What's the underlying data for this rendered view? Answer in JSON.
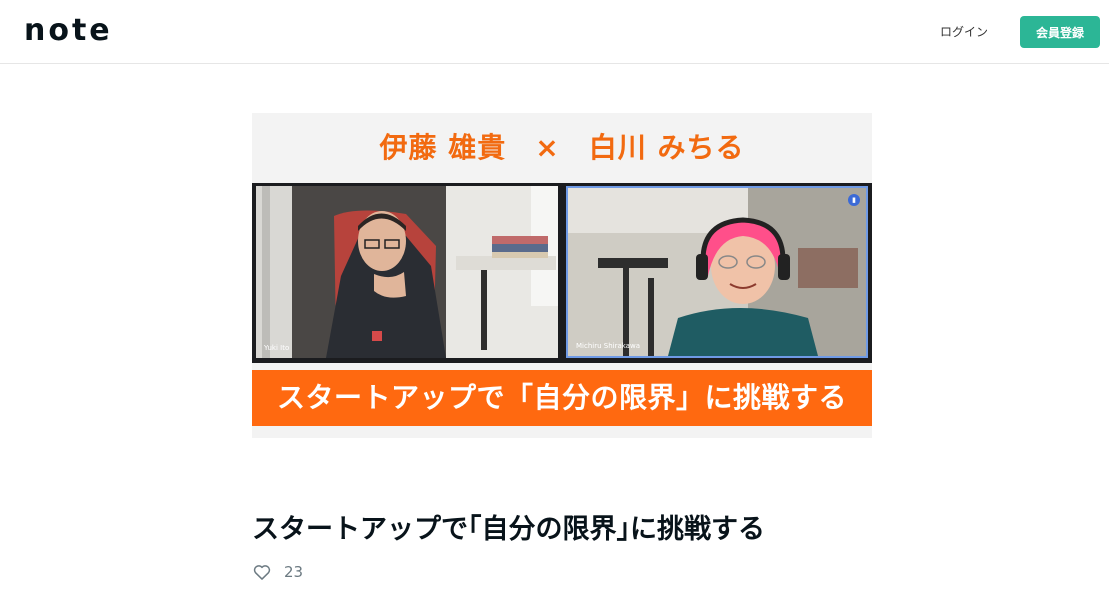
{
  "header": {
    "logo": "note",
    "login_label": "ログイン",
    "signup_label": "会員登録"
  },
  "hero": {
    "top_text": "伊藤 雄貴　×　白川 みちる",
    "bottom_text": "スタートアップで「自分の限界」に挑戦する",
    "left_caption": "Yuki Ito",
    "right_caption": "Michiru Shirakawa"
  },
  "article": {
    "title": "スタートアップで｢自分の限界｣に挑戦する",
    "like_count": "23"
  },
  "colors": {
    "brand": "#2cb696",
    "accent_orange": "#ff6910",
    "text": "#08131a"
  },
  "icons": [
    "heart-icon",
    "mic-icon"
  ]
}
